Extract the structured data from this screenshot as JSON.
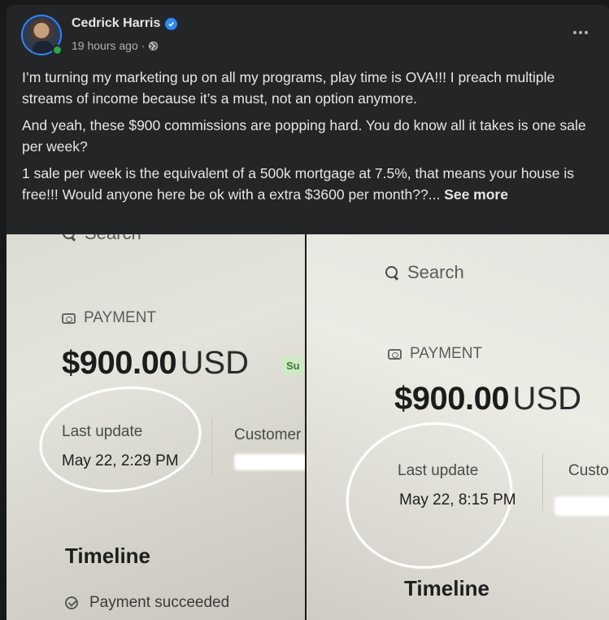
{
  "post": {
    "author": "Cedrick Harris",
    "timestamp": "19 hours ago",
    "separator": "·",
    "paragraphs": [
      "I’m turning my marketing up on all my programs, play time is OVA!!! I preach multiple streams of income because it’s a must, not an option anymore.",
      "And yeah, these $900 commissions are popping hard. You do know all it takes is one sale per week?",
      "1 sale per week is the equivalent of a 500k mortgage at 7.5%, that means your house is free!!!  Would anyone here be ok with a extra $3600 per month??..."
    ],
    "see_more": "See more",
    "icons": {
      "verified": "verified-badge-icon",
      "privacy": "globe-icon",
      "menu": "more-options-icon"
    },
    "colors": {
      "background": "#242526",
      "verified": "#2d88ff",
      "online": "#31a24c"
    }
  },
  "photos": {
    "left": {
      "search_label": "Search",
      "section_label": "PAYMENT",
      "amount": "$900.00",
      "currency": "USD",
      "status_badge": "Su",
      "last_update_label": "Last update",
      "last_update_value": "May 22, 2:29 PM",
      "customer_label": "Customer",
      "timeline_label": "Timeline",
      "event_label": "Payment succeeded"
    },
    "right": {
      "search_label": "Search",
      "section_label": "PAYMENT",
      "amount": "$900.00",
      "currency": "USD",
      "last_update_label": "Last update",
      "last_update_value": "May 22, 8:15 PM",
      "customer_label": "Custo",
      "timeline_label": "Timeline"
    }
  }
}
